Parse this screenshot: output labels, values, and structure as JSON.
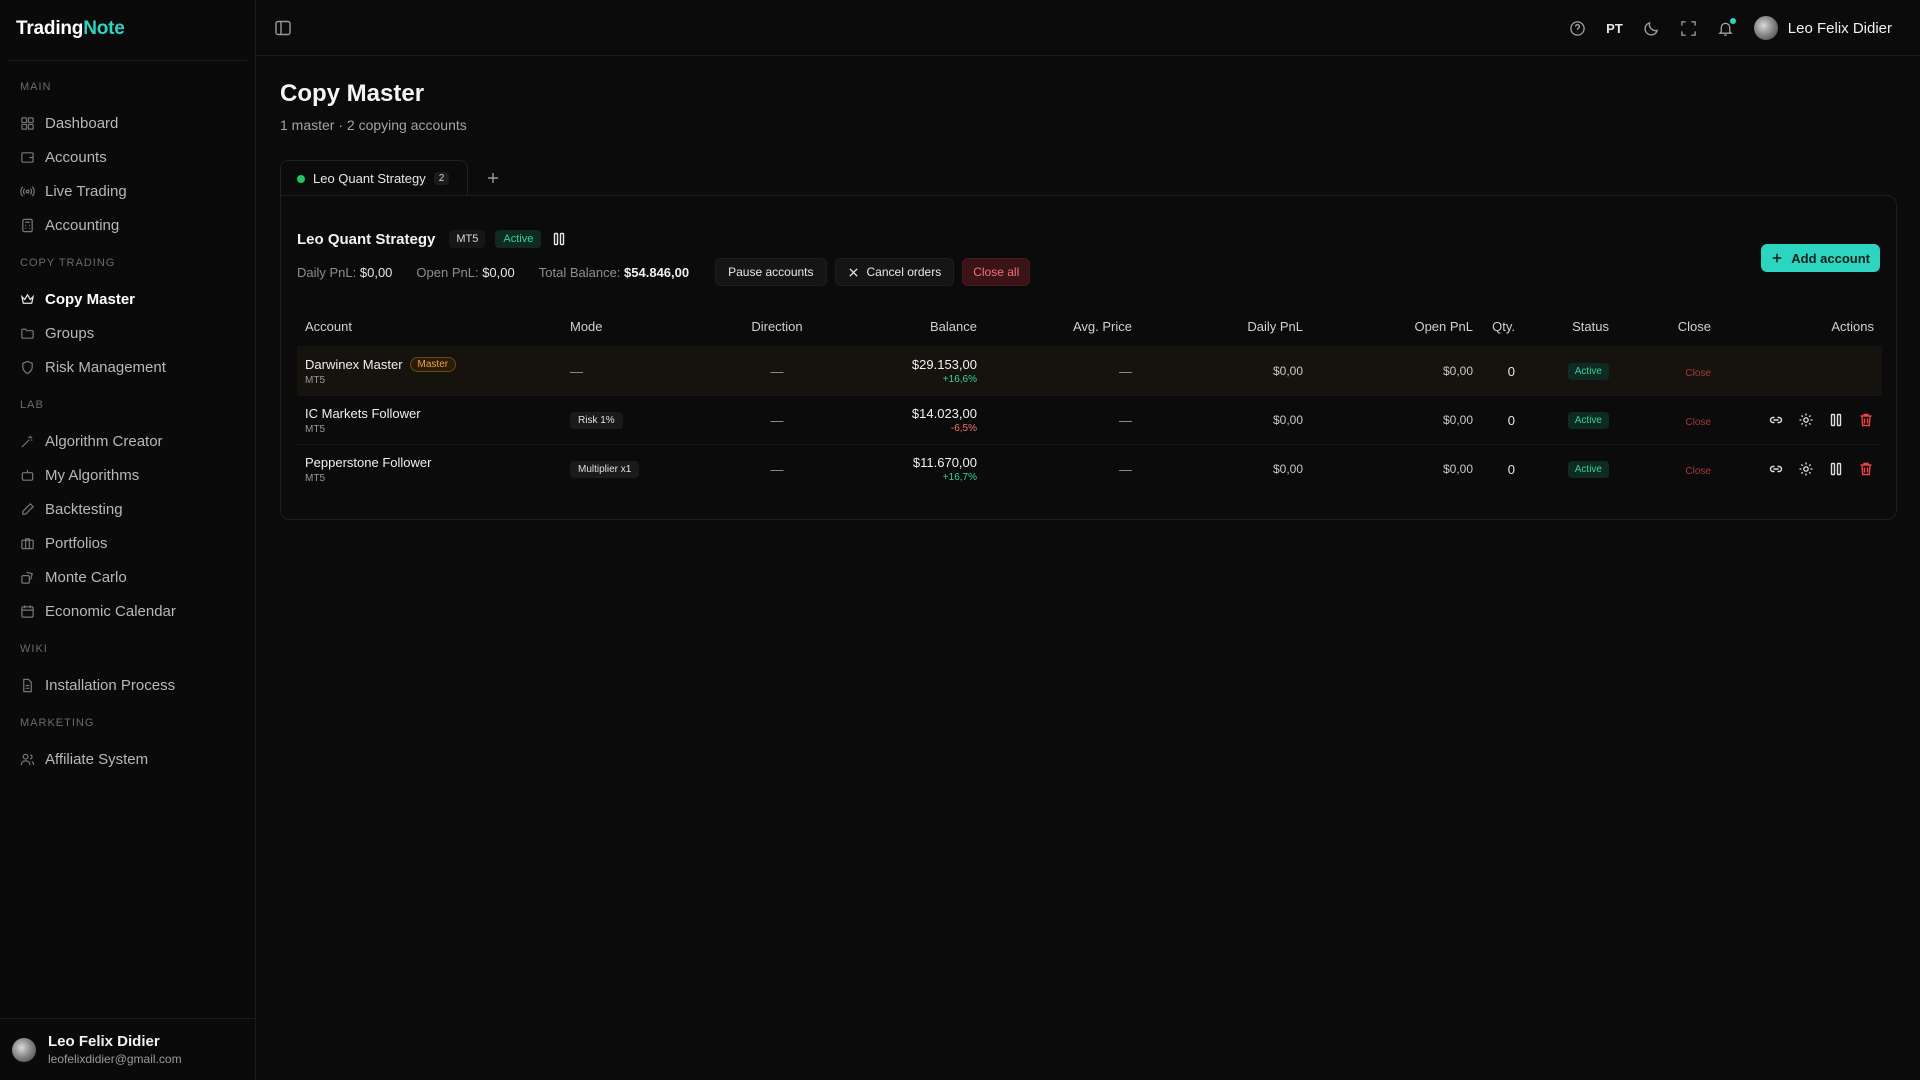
{
  "brand": {
    "part1": "Trading",
    "part2": "Note",
    "accent": "#2dd4bf"
  },
  "sidebar": {
    "sections": [
      {
        "label": "MAIN",
        "items": [
          {
            "label": "Dashboard",
            "icon": "grid-icon"
          },
          {
            "label": "Accounts",
            "icon": "wallet-icon"
          },
          {
            "label": "Live Trading",
            "icon": "radio-icon"
          },
          {
            "label": "Accounting",
            "icon": "calculator-icon"
          }
        ]
      },
      {
        "label": "COPY TRADING",
        "items": [
          {
            "label": "Copy Master",
            "icon": "crown-icon",
            "active": true
          },
          {
            "label": "Groups",
            "icon": "folder-icon"
          },
          {
            "label": "Risk Management",
            "icon": "shield-icon"
          }
        ]
      },
      {
        "label": "LAB",
        "items": [
          {
            "label": "Algorithm Creator",
            "icon": "wand-icon"
          },
          {
            "label": "My Algorithms",
            "icon": "bot-icon"
          },
          {
            "label": "Backtesting",
            "icon": "pencil-icon"
          },
          {
            "label": "Portfolios",
            "icon": "briefcase-icon"
          },
          {
            "label": "Monte Carlo",
            "icon": "dice-icon"
          },
          {
            "label": "Economic Calendar",
            "icon": "calendar-icon"
          }
        ]
      },
      {
        "label": "WIKI",
        "items": [
          {
            "label": "Installation Process",
            "icon": "document-icon"
          }
        ]
      },
      {
        "label": "MARKETING",
        "items": [
          {
            "label": "Affiliate System",
            "icon": "users-icon"
          }
        ]
      }
    ],
    "footer": {
      "name": "Leo Felix Didier",
      "email": "leofelixdidier@gmail.com"
    }
  },
  "topbar": {
    "lang": "PT",
    "user": "Leo Felix Didier"
  },
  "page": {
    "title": "Copy Master",
    "subtitle": "1 master · 2 copying accounts"
  },
  "tab": {
    "label": "Leo Quant Strategy",
    "count": "2"
  },
  "strategy": {
    "name": "Leo Quant Strategy",
    "platform": "MT5",
    "status": "Active",
    "daily_pnl_label": "Daily PnL:",
    "daily_pnl": "$0,00",
    "open_pnl_label": "Open PnL:",
    "open_pnl": "$0,00",
    "total_balance_label": "Total Balance:",
    "total_balance": "$54.846,00",
    "pause_label": "Pause accounts",
    "cancel_label": "Cancel orders",
    "close_all_label": "Close all",
    "add_account_label": "Add account"
  },
  "table": {
    "headers": {
      "account": "Account",
      "mode": "Mode",
      "direction": "Direction",
      "balance": "Balance",
      "avg_price": "Avg. Price",
      "daily_pnl": "Daily PnL",
      "open_pnl": "Open PnL",
      "qty": "Qty.",
      "status": "Status",
      "close": "Close",
      "actions": "Actions"
    },
    "rows": [
      {
        "name": "Darwinex Master",
        "badge": "Master",
        "platform": "MT5",
        "mode": "—",
        "direction": "—",
        "balance": "$29.153,00",
        "change": "+16,6%",
        "avg_price": "—",
        "daily_pnl": "$0,00",
        "open_pnl": "$0,00",
        "qty": "0",
        "status": "Active",
        "close": "Close"
      },
      {
        "name": "IC Markets Follower",
        "platform": "MT5",
        "mode": "Risk 1%",
        "direction": "—",
        "balance": "$14.023,00",
        "change": "-6,5%",
        "avg_price": "—",
        "daily_pnl": "$0,00",
        "open_pnl": "$0,00",
        "qty": "0",
        "status": "Active",
        "close": "Close"
      },
      {
        "name": "Pepperstone Follower",
        "platform": "MT5",
        "mode": "Multiplier x1",
        "direction": "—",
        "balance": "$11.670,00",
        "change": "+16,7%",
        "avg_price": "—",
        "daily_pnl": "$0,00",
        "open_pnl": "$0,00",
        "qty": "0",
        "status": "Active",
        "close": "Close"
      }
    ]
  }
}
